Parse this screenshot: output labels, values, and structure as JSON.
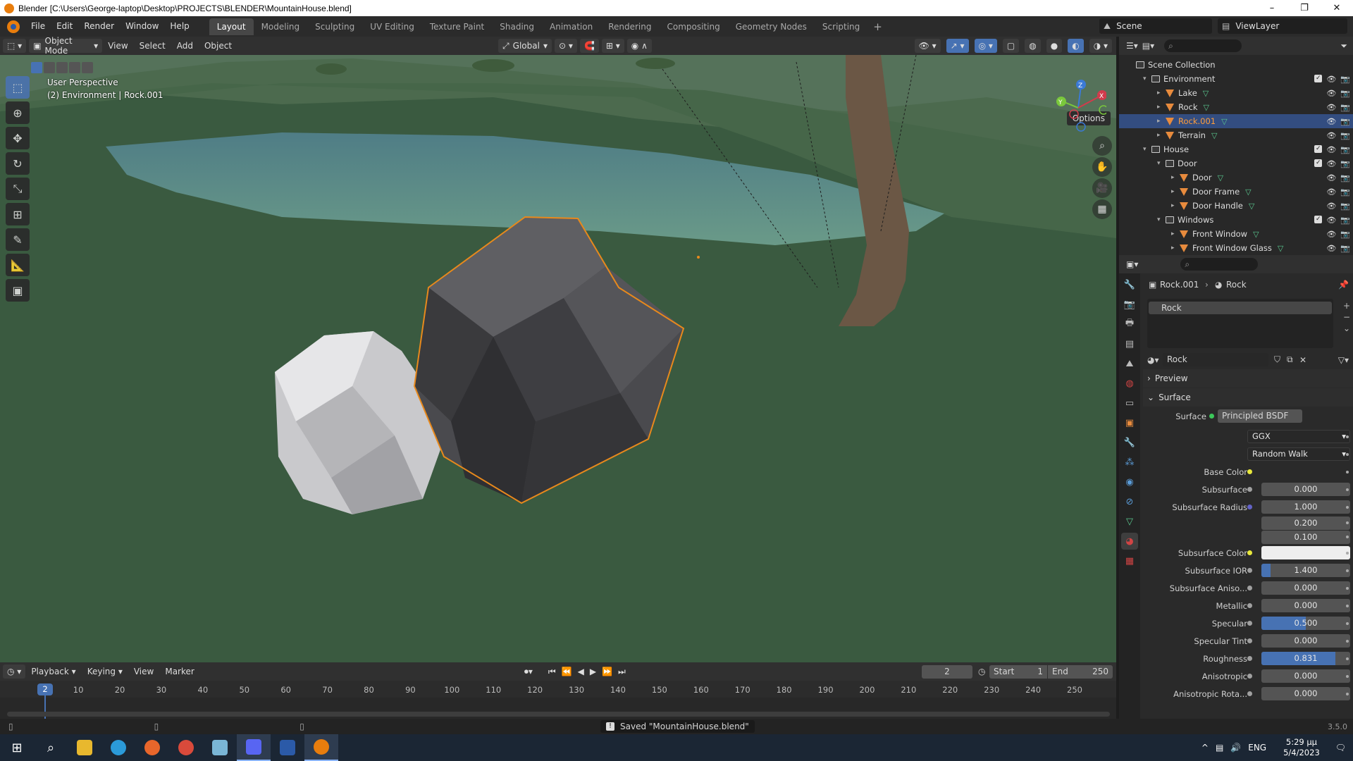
{
  "window": {
    "title": "Blender [C:\\Users\\George-laptop\\Desktop\\PROJECTS\\BLENDER\\MountainHouse.blend]",
    "controls": [
      "–",
      "❐",
      "✕"
    ]
  },
  "menubar": {
    "menus": [
      "File",
      "Edit",
      "Render",
      "Window",
      "Help"
    ],
    "workspaces": [
      "Layout",
      "Modeling",
      "Sculpting",
      "UV Editing",
      "Texture Paint",
      "Shading",
      "Animation",
      "Rendering",
      "Compositing",
      "Geometry Nodes",
      "Scripting"
    ],
    "active_workspace": "Layout",
    "add_workspace": "+",
    "scene": "Scene",
    "view_layer": "ViewLayer"
  },
  "viewport_header": {
    "mode": "Object Mode",
    "menus": [
      "View",
      "Select",
      "Add",
      "Object"
    ],
    "orientation": "Global"
  },
  "viewport": {
    "perspective_label": "User Perspective",
    "object_label": "(2) Environment | Rock.001",
    "options_label": "Options",
    "gizmo_axes": [
      "X",
      "Y",
      "Z"
    ]
  },
  "outliner": {
    "root": "Scene Collection",
    "rows": [
      {
        "name": "Environment",
        "type": "collection",
        "level": 0,
        "expanded": true,
        "checked": true
      },
      {
        "name": "Lake",
        "type": "object",
        "level": 1
      },
      {
        "name": "Rock",
        "type": "object",
        "level": 1
      },
      {
        "name": "Rock.001",
        "type": "object",
        "level": 1,
        "selected": true
      },
      {
        "name": "Terrain",
        "type": "object",
        "level": 1
      },
      {
        "name": "House",
        "type": "collection",
        "level": 0,
        "expanded": true,
        "checked": true
      },
      {
        "name": "Door",
        "type": "collection",
        "level": 1,
        "expanded": true,
        "checked": true
      },
      {
        "name": "Door",
        "type": "object",
        "level": 2
      },
      {
        "name": "Door Frame",
        "type": "object",
        "level": 2
      },
      {
        "name": "Door Handle",
        "type": "object",
        "level": 2
      },
      {
        "name": "Windows",
        "type": "collection",
        "level": 1,
        "expanded": true,
        "checked": true
      },
      {
        "name": "Front Window",
        "type": "object",
        "level": 2
      },
      {
        "name": "Front Window Glass",
        "type": "object",
        "level": 2
      }
    ]
  },
  "properties": {
    "breadcrumb_object": "Rock.001",
    "breadcrumb_material": "Rock",
    "material_slot": "Rock",
    "material_name": "Rock",
    "panels": {
      "preview": "Preview",
      "surface": "Surface"
    },
    "surface_label": "Surface",
    "surface_shader": "Principled BSDF",
    "distribution": "GGX",
    "subsurface_method": "Random Walk",
    "fields": [
      {
        "label": "Base Color",
        "value": "",
        "socket": "y",
        "kind": "color-none"
      },
      {
        "label": "Subsurface",
        "value": "0.000",
        "socket": "gray",
        "fill": 0
      },
      {
        "label": "Subsurface Radius",
        "value": "1.000",
        "socket": "b",
        "fill": 0
      },
      {
        "label": "",
        "value": "0.200",
        "socket": "",
        "fill": 0
      },
      {
        "label": "",
        "value": "0.100",
        "socket": "",
        "fill": 0
      },
      {
        "label": "Subsurface Color",
        "value": "",
        "socket": "y",
        "kind": "color-white"
      },
      {
        "label": "Subsurface IOR",
        "value": "1.400",
        "socket": "gray",
        "fill": 0.1
      },
      {
        "label": "Subsurface Aniso...",
        "value": "0.000",
        "socket": "gray",
        "fill": 0
      },
      {
        "label": "Metallic",
        "value": "0.000",
        "socket": "gray",
        "fill": 0
      },
      {
        "label": "Specular",
        "value": "0.500",
        "socket": "gray",
        "fill": 0.5
      },
      {
        "label": "Specular Tint",
        "value": "0.000",
        "socket": "gray",
        "fill": 0
      },
      {
        "label": "Roughness",
        "value": "0.831",
        "socket": "gray",
        "fill": 0.831
      },
      {
        "label": "Anisotropic",
        "value": "0.000",
        "socket": "gray",
        "fill": 0
      },
      {
        "label": "Anisotropic Rota...",
        "value": "0.000",
        "socket": "gray",
        "fill": 0
      }
    ]
  },
  "timeline": {
    "menus": [
      "Playback",
      "Keying",
      "View",
      "Marker"
    ],
    "current_frame": "2",
    "start_label": "Start",
    "start": "1",
    "end_label": "End",
    "end": "250",
    "ticks": [
      "10",
      "20",
      "30",
      "40",
      "50",
      "60",
      "70",
      "80",
      "90",
      "100",
      "110",
      "120",
      "130",
      "140",
      "150",
      "160",
      "170",
      "180",
      "190",
      "200",
      "210",
      "220",
      "230",
      "240",
      "250"
    ],
    "indicator": "2"
  },
  "statusbar": {
    "message": "Saved \"MountainHouse.blend\"",
    "version": "3.5.0"
  },
  "taskbar": {
    "language": "ENG",
    "time": "5:29 μμ",
    "date": "5/4/2023"
  },
  "colors": {
    "accent": "#4772b3",
    "selection_outline": "#e8891c",
    "ground": "#3b5a40"
  }
}
